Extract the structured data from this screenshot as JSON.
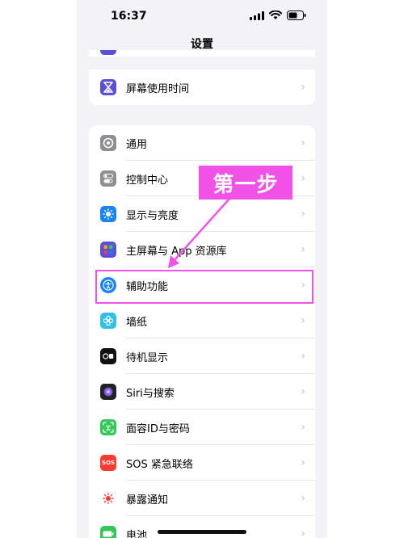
{
  "status_bar": {
    "time": "16:37"
  },
  "nav": {
    "title": "设置"
  },
  "top_group": {
    "items": [
      {
        "label": "屏幕使用时间",
        "icon": "hourglass-icon",
        "color": "#5b4fd6"
      }
    ]
  },
  "main_group": {
    "items": [
      {
        "label": "通用",
        "icon": "gear-icon",
        "color": "#8e8e93"
      },
      {
        "label": "控制中心",
        "icon": "toggle-icon",
        "color": "#8e8e93"
      },
      {
        "label": "显示与亮度",
        "icon": "sun-icon",
        "color": "#1a84ff"
      },
      {
        "label": "主屏幕与 App 资源库",
        "icon": "grid-icon",
        "color": "#5b4fd6"
      },
      {
        "label": "辅助功能",
        "icon": "accessibility-icon",
        "color": "#1a84ff"
      },
      {
        "label": "墙纸",
        "icon": "flower-icon",
        "color": "#30c0e8"
      },
      {
        "label": "待机显示",
        "icon": "standby-icon",
        "color": "#111111"
      },
      {
        "label": "Siri与搜索",
        "icon": "siri-icon",
        "color": "#222222"
      },
      {
        "label": "面容ID与密码",
        "icon": "faceid-icon",
        "color": "#34c759"
      },
      {
        "label": "SOS 紧急联络",
        "icon": "sos-icon",
        "color": "#ff3b30"
      },
      {
        "label": "暴露通知",
        "icon": "exposure-icon",
        "color": "#ffffff"
      },
      {
        "label": "电池",
        "icon": "battery-icon",
        "color": "#34c759"
      }
    ]
  },
  "annotation": {
    "label": "第一步",
    "color": "#f052e8"
  }
}
